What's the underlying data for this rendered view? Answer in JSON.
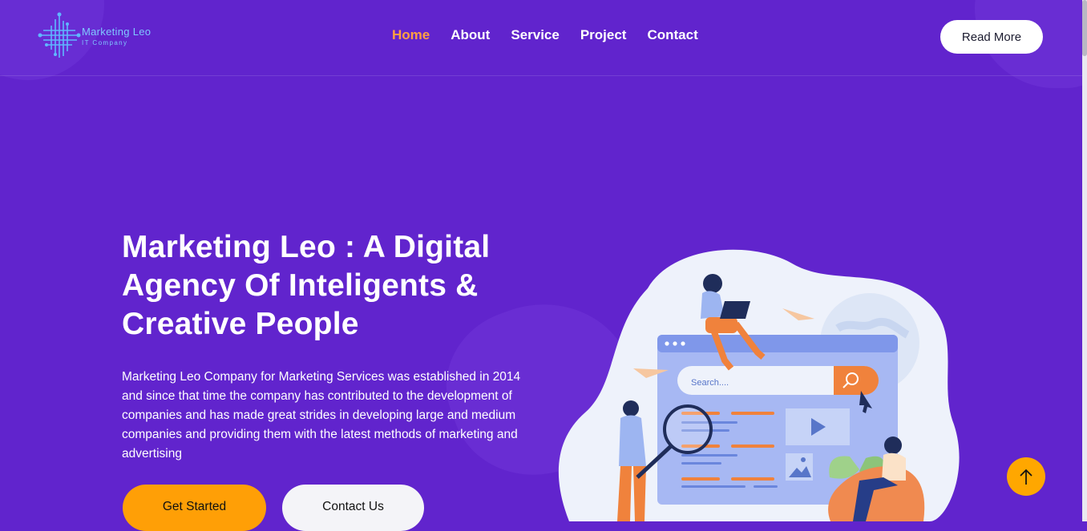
{
  "brand": {
    "name": "Marketing Leo",
    "tagline": "IT Company"
  },
  "nav": {
    "items": [
      {
        "label": "Home",
        "active": true
      },
      {
        "label": "About",
        "active": false
      },
      {
        "label": "Service",
        "active": false
      },
      {
        "label": "Project",
        "active": false
      },
      {
        "label": "Contact",
        "active": false
      }
    ]
  },
  "header": {
    "cta_label": "Read More"
  },
  "hero": {
    "title_lines": [
      "Marketing Leo : A Digital",
      "Agency Of Inteligents &",
      "Creative People"
    ],
    "description": "Marketing Leo Company for Marketing Services was established in 2014 and since that time the company has contributed to the development of companies and has made great strides in developing large and medium companies and providing them with the latest methods of marketing and advertising",
    "primary_button": "Get Started",
    "secondary_button": "Contact Us"
  },
  "illustration": {
    "search_placeholder": "Search....",
    "icons": [
      "search-icon",
      "play-icon",
      "image-icon",
      "cursor-icon",
      "magnifier-icon",
      "paper-plane-icon",
      "laptop-icon"
    ]
  },
  "scroll_top": {
    "icon": "arrow-up-icon"
  },
  "colors": {
    "background": "#6124cd",
    "accent": "#ff9f06",
    "active_nav": "#ff9f43",
    "white": "#ffffff"
  }
}
